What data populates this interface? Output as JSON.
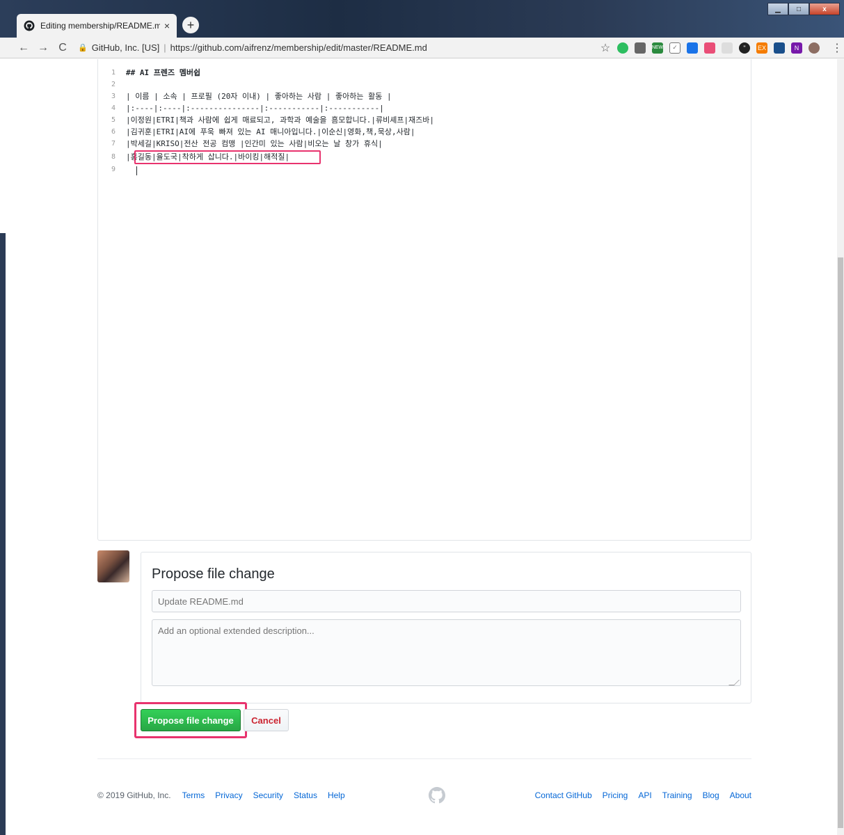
{
  "browser": {
    "tab_title": "Editing membership/README.m",
    "tab_close": "×",
    "new_tab": "+",
    "back": "←",
    "forward": "→",
    "reload": "C",
    "site_identity": "GitHub, Inc. [US]",
    "url": "https://github.com/aifrenz/membership/edit/master/README.md",
    "extensions": [
      "evernote-icon",
      "extension-icon",
      "new-badge-icon",
      "pocket-icon",
      "extension-icon-2",
      "extension-icon-3",
      "extension-icon-4",
      "quote-icon",
      "ex-icon",
      "cursor-icon",
      "onenote-icon"
    ],
    "colors": {
      "titlebar": "#1d2d44",
      "toolbar": "#f2f2f2"
    }
  },
  "editor": {
    "lines": [
      {
        "n": "1",
        "text": "## AI 프렌즈 멤버쉽",
        "bold": true
      },
      {
        "n": "2",
        "text": ""
      },
      {
        "n": "3",
        "text": "| 이름 | 소속 | 프로필 (20자 이내) | 좋아하는 사람 | 좋아하는 활동 |"
      },
      {
        "n": "4",
        "text": "|:----|:----|:---------------|:-----------|:-----------|"
      },
      {
        "n": "5",
        "text": "|이정원|ETRI|책과 사람에 쉽게 매료되고, 과학과 예술을 흠모합니다.|류비셰프|재즈바|"
      },
      {
        "n": "6",
        "text": "|김귀훈|ETRI|AI에 푸욱 빠져 있는 AI 매니아입니다.|이순신|영화,책,묵상,사람|"
      },
      {
        "n": "7",
        "text": "|박세길|KRISO|전산 전공 컴맹 |인간미 있는 사람|비오는 날 창가 휴식|"
      },
      {
        "n": "8",
        "text": "|홍길동|율도국|착하게 삽니다.|바이킹|해적질|"
      },
      {
        "n": "9",
        "text": ""
      }
    ],
    "highlight_color": "#e8336e"
  },
  "commit": {
    "title": "Propose file change",
    "summary_placeholder": "Update README.md",
    "description_placeholder": "Add an optional extended description...",
    "submit_label": "Propose file change",
    "cancel_label": "Cancel",
    "colors": {
      "submit": "#28a745",
      "cancel_text": "#cb2431"
    }
  },
  "footer": {
    "copyright": "© 2019 GitHub, Inc.",
    "left_links": [
      "Terms",
      "Privacy",
      "Security",
      "Status",
      "Help"
    ],
    "right_links": [
      "Contact GitHub",
      "Pricing",
      "API",
      "Training",
      "Blog",
      "About"
    ]
  }
}
